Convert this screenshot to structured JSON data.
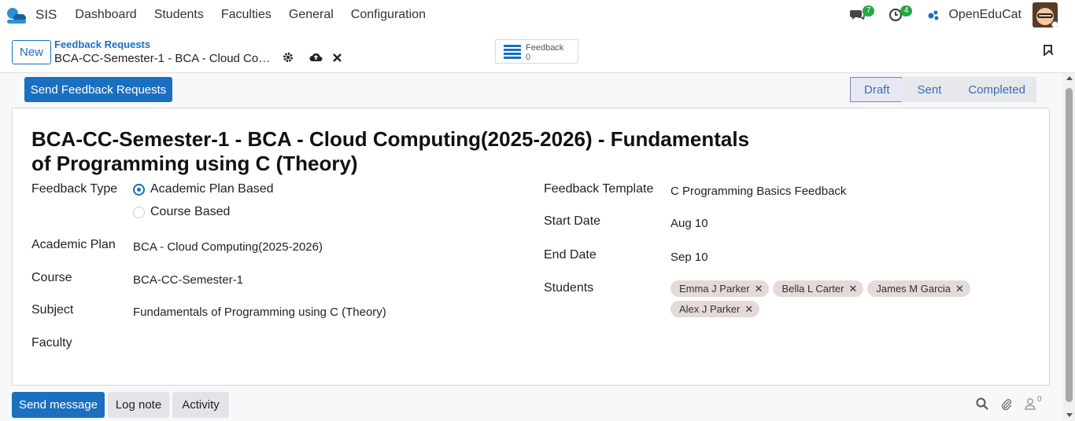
{
  "app": {
    "name": "SIS"
  },
  "menu": [
    "Dashboard",
    "Students",
    "Faculties",
    "General",
    "Configuration"
  ],
  "systray": {
    "messages_count": "7",
    "activities_count": "4",
    "company": "OpenEduCat"
  },
  "control_panel": {
    "new_label": "New",
    "breadcrumb_parent": "Feedback Requests",
    "breadcrumb_current": "BCA-CC-Semester-1 - BCA - Cloud Computing(2025-2026) - Fundamentals of Programming using C (Theory)",
    "smart_button": {
      "label": "Feedback",
      "value": "0"
    }
  },
  "header": {
    "send_button": "Send Feedback Requests",
    "stages": [
      {
        "label": "Draft",
        "active": true
      },
      {
        "label": "Sent",
        "active": false
      },
      {
        "label": "Completed",
        "active": false
      }
    ]
  },
  "form": {
    "title": "BCA-CC-Semester-1 - BCA - Cloud Computing(2025-2026) - Fundamentals of Programming using C (Theory)",
    "labels": {
      "feedback_type": "Feedback Type",
      "academic_plan": "Academic Plan",
      "course": "Course",
      "subject": "Subject",
      "faculty": "Faculty",
      "feedback_template": "Feedback Template",
      "start_date": "Start Date",
      "end_date": "End Date",
      "students": "Students"
    },
    "feedback_type_options": [
      "Academic Plan Based",
      "Course Based"
    ],
    "feedback_type_selected": "Academic Plan Based",
    "academic_plan": "BCA - Cloud Computing(2025-2026)",
    "course": "BCA-CC-Semester-1",
    "subject": "Fundamentals of Programming using C (Theory)",
    "faculty": "",
    "feedback_template": "C Programming Basics Feedback",
    "start_date": "Aug 10",
    "end_date": "Sep 10",
    "students": [
      "Emma J Parker",
      "Bella L Carter",
      "James M Garcia",
      "Alex J Parker"
    ]
  },
  "chatter": {
    "send_message": "Send message",
    "log_note": "Log note",
    "activity": "Activity",
    "followers_count": "0"
  },
  "colors": {
    "primary": "#1a6fbf",
    "badge": "#28a745",
    "tag_bg": "#e4dad8"
  }
}
